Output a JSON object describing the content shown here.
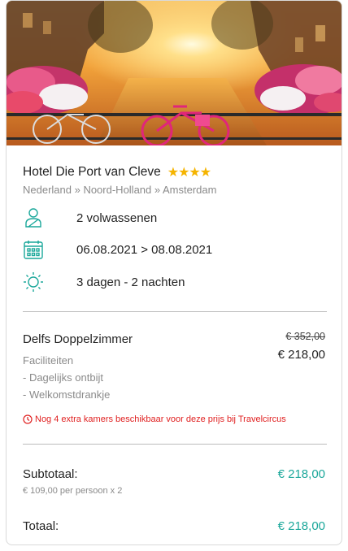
{
  "hotel": {
    "name": "Hotel Die Port van Cleve",
    "stars": "★★★★",
    "location": "Nederland » Noord-Holland » Amsterdam"
  },
  "details": {
    "guests": "2 volwassenen",
    "dates": "06.08.2021 > 08.08.2021",
    "duration": "3 dagen - 2 nachten"
  },
  "room": {
    "name": "Delfs Doppelzimmer",
    "old_price": "€ 352,00",
    "price": "€ 218,00",
    "facilities_title": "Faciliteiten",
    "facilities": [
      "- Dagelijks ontbijt",
      "- Welkomstdrankje"
    ],
    "availability_notice": "Nog 4 extra kamers beschikbaar voor deze prijs bij Travelcircus"
  },
  "summary": {
    "subtotal_label": "Subtotaal:",
    "subtotal_value": "€ 218,00",
    "per_person": "€ 109,00 per persoon x 2",
    "total_label": "Totaal:",
    "total_value": "€ 218,00"
  },
  "colors": {
    "accent": "#1aa79a",
    "star": "#f5b400",
    "alert": "#e02020",
    "muted": "#8a8a8a"
  },
  "icons": {
    "guests": "person-icon",
    "dates": "calendar-icon",
    "duration": "sun-icon",
    "alert": "clock-icon"
  }
}
